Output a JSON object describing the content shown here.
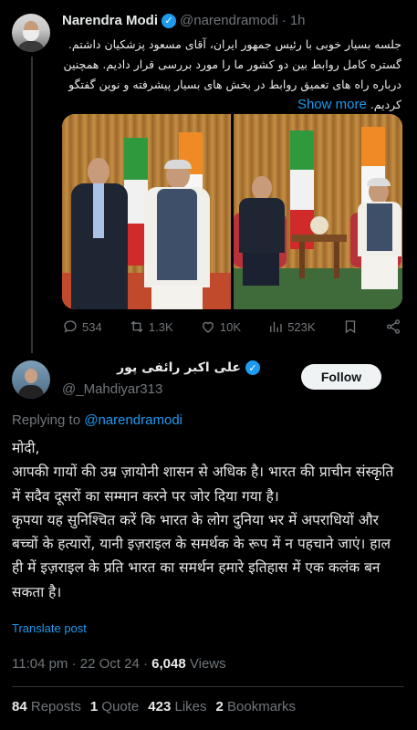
{
  "original_tweet": {
    "author_name": "Narendra Modi",
    "handle": "@narendramodi",
    "separator": "·",
    "time": "1h",
    "text": "جلسه بسیار خوبی با رئیس جمهور ایران، آقای مسعود پزشکیان داشتم. گستره کامل روابط بین دو کشور ما را مورد بررسی قرار دادیم. همچنین درباره راه های تعمیق روابط در بخش های بسیار پیشرفته و نوین گفتگو کردیم.",
    "show_more": "Show more",
    "actions": {
      "replies": "534",
      "reposts": "1.3K",
      "likes": "10K",
      "views": "523K"
    }
  },
  "reply": {
    "author_name": "علی اکبر رائفی پور",
    "handle": "@_Mahdiyar313",
    "follow_label": "Follow",
    "replying_prefix": "Replying to",
    "replying_to": "@narendramodi",
    "body_lines": [
      "मोदी,",
      "आपकी गायों की उम्र ज़ायोनी शासन से अधिक है। भारत की प्राचीन संस्कृति में सदैव दूसरों का सम्मान करने पर जोर दिया गया है।",
      "कृपया यह सुनिश्चित करें कि भारत के लोग दुनिया भर में अपराधियों और बच्चों के हत्यारों, यानी इज़राइल के समर्थक के रूप में न पहचाने जाएं। हाल ही में इज़राइल के प्रति भारत का समर्थन हमारे इतिहास में एक कलंक बन सकता है।"
    ],
    "translate_label": "Translate post",
    "time": "11:04 pm",
    "date": "22 Oct 24",
    "meta_separator": "·",
    "views_count": "6,048",
    "views_label": "Views",
    "stats": {
      "reposts_count": "84",
      "reposts_label": "Reposts",
      "quotes_count": "1",
      "quotes_label": "Quote",
      "likes_count": "423",
      "likes_label": "Likes",
      "bookmarks_count": "2",
      "bookmarks_label": "Bookmarks"
    }
  },
  "colors": {
    "background": "#000000",
    "text": "#e7e9ea",
    "muted": "#71767b",
    "accent": "#1d9bf0"
  }
}
